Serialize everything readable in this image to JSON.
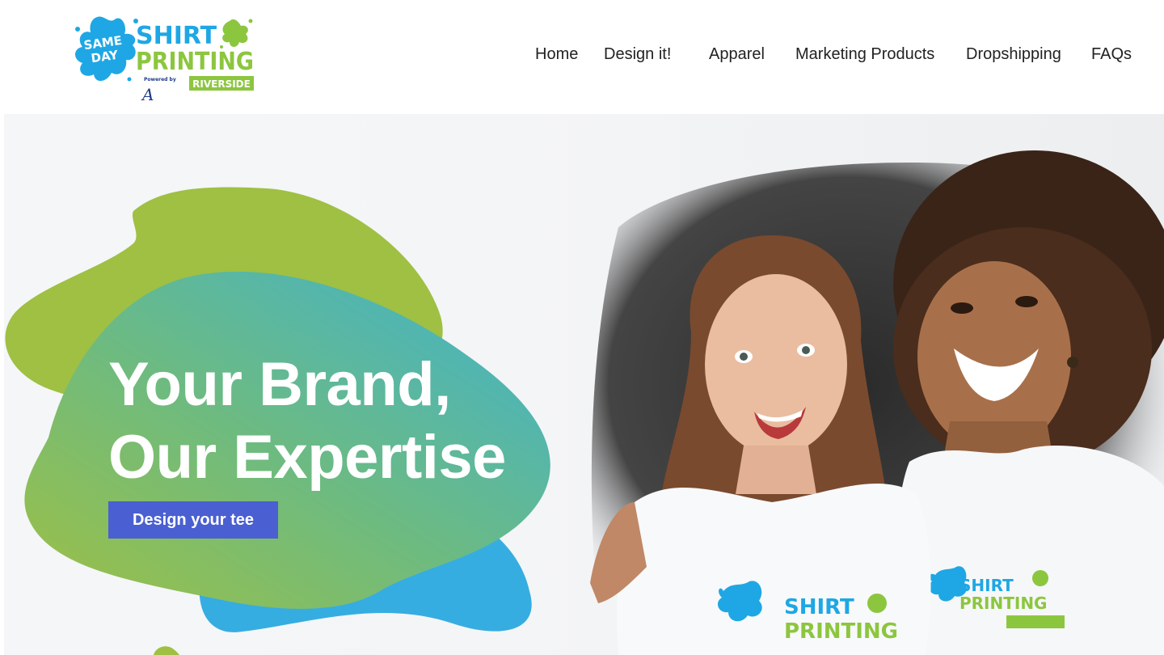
{
  "brand": {
    "logo_line1": "SAME",
    "logo_line2": "DAY",
    "logo_word1": "SHIRT",
    "logo_word2": "PRINTING",
    "logo_powered": "Powered by",
    "logo_location": "RIVERSIDE"
  },
  "nav": {
    "items": [
      {
        "label": "Home"
      },
      {
        "label": "Design it!"
      },
      {
        "label": "Apparel"
      },
      {
        "label": "Marketing Products"
      },
      {
        "label": "Dropshipping"
      },
      {
        "label": "FAQs"
      }
    ]
  },
  "hero": {
    "headline_line1": "Your Brand,",
    "headline_line2": "Our Expertise",
    "cta_label": "Design your tee"
  },
  "colors": {
    "brand_blue": "#1ea7e4",
    "brand_green": "#8cc63f",
    "cta_blue": "#4a5fd1",
    "blob_green": "#9fc043",
    "blob_teal": "#4db6c4",
    "blob_blue": "#36ade0"
  }
}
